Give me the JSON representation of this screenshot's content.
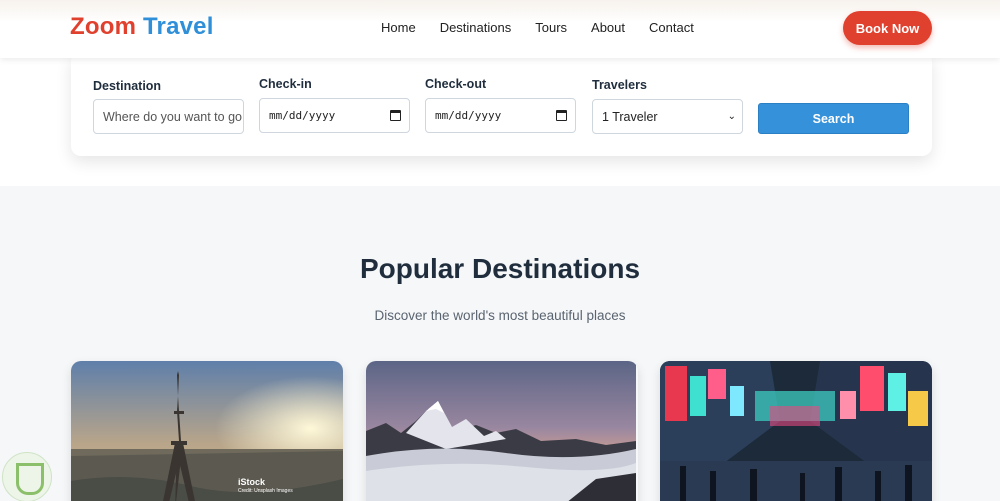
{
  "header": {
    "logo_part1": "Zoom",
    "logo_part2": "Travel",
    "nav": [
      "Home",
      "Destinations",
      "Tours",
      "About",
      "Contact"
    ],
    "book_label": "Book Now"
  },
  "search": {
    "destination_label": "Destination",
    "destination_placeholder": "Where do you want to go",
    "checkin_label": "Check-in",
    "checkin_value": "mm/dd/yyyy",
    "checkout_label": "Check-out",
    "checkout_value": "mm/dd/yyyy",
    "travelers_label": "Travelers",
    "travelers_value": "1 Traveler",
    "search_label": "Search"
  },
  "section": {
    "title": "Popular Destinations",
    "subtitle": "Discover the world's most beautiful places"
  },
  "cards": [
    {
      "image": "eiffel-tower-paris",
      "watermark": "iStock",
      "credit": "Credit: Unsplash Images"
    },
    {
      "image": "mountain-peaks-sunset"
    },
    {
      "image": "neon-city-street"
    }
  ],
  "colors": {
    "accent_red": "#e0412e",
    "accent_blue": "#2f8fd8",
    "search_button": "#3591da"
  }
}
